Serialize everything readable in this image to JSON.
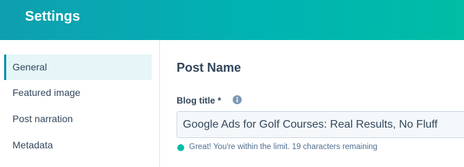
{
  "header": {
    "title": "Settings"
  },
  "sidebar": {
    "items": [
      {
        "label": "General",
        "active": true
      },
      {
        "label": "Featured image"
      },
      {
        "label": "Post narration"
      },
      {
        "label": "Metadata"
      }
    ]
  },
  "main": {
    "section_title": "Post Name",
    "field_label": "Blog title *",
    "field_info_icon": "info-icon",
    "title_value": "Google Ads for Golf Courses: Real Results, No Fluff",
    "status_text": "Great! You're within the limit. 19 characters remaining",
    "status_color": "#00bda5"
  },
  "colors": {
    "header_gradient_start": "#0f9fb0",
    "header_gradient_end": "#00bda5",
    "active_nav_bg": "#e5f5f8",
    "active_nav_border": "#0091ae"
  }
}
